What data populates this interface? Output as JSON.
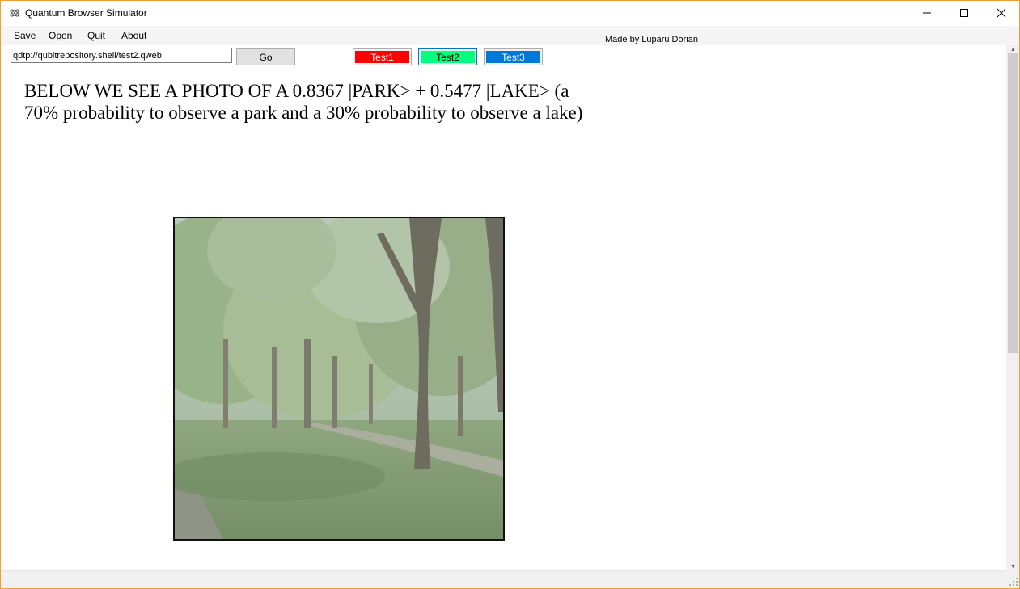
{
  "window": {
    "title": "Quantum Browser Simulator",
    "icon": "quantum-app-icon"
  },
  "menu": {
    "items": [
      "Save",
      "Open",
      "Quit",
      "About"
    ]
  },
  "credit": "Made by Luparu Dorian",
  "toolbar": {
    "address_value": "qdtp://qubitrepository.shell/test2.qweb",
    "go_label": "Go",
    "tests": [
      {
        "label": "Test1",
        "color": "#ff0000",
        "text_color": "#ffffff"
      },
      {
        "label": "Test2",
        "color": "#00ff7f",
        "text_color": "#000000"
      },
      {
        "label": "Test3",
        "color": "#0078d7",
        "text_color": "#ffffff"
      }
    ]
  },
  "content": {
    "heading": "BELOW WE SEE A PHOTO OF A 0.8367 |PARK> + 0.5477 |LAKE> (a 70% probability to observe a park and a 30% probability to observe a lake)",
    "photo_subject": "park-photo"
  },
  "colors": {
    "window_border": "#f0a030",
    "scroll_thumb": "#cdcdcd"
  }
}
